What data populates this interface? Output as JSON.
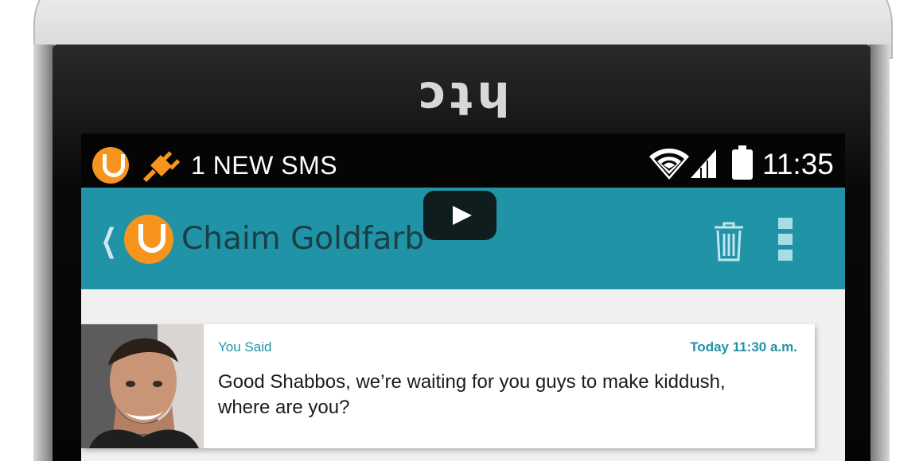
{
  "device": {
    "brand": "htc"
  },
  "status_bar": {
    "app_icon": "viber-like-app-icon",
    "plug_icon": "charging-plug-icon",
    "notification_text": "1 NEW SMS",
    "wifi_icon": "wifi-icon",
    "signal_icon": "signal-icon",
    "battery_icon": "battery-icon",
    "time": "11:35"
  },
  "app_bar": {
    "back_icon": "chevron-left-icon",
    "contact_name": "Chaim Goldfarb",
    "delete_icon": "trash-icon",
    "menu_icon": "more-vertical-icon",
    "accent_color": "#2193a6"
  },
  "video_overlay": {
    "icon": "play-icon"
  },
  "messages": [
    {
      "label": "You Said",
      "timestamp": "Today 11:30 a.m.",
      "body": "Good Shabbos, we’re waiting for you guys to make kiddush, where are you?"
    }
  ]
}
